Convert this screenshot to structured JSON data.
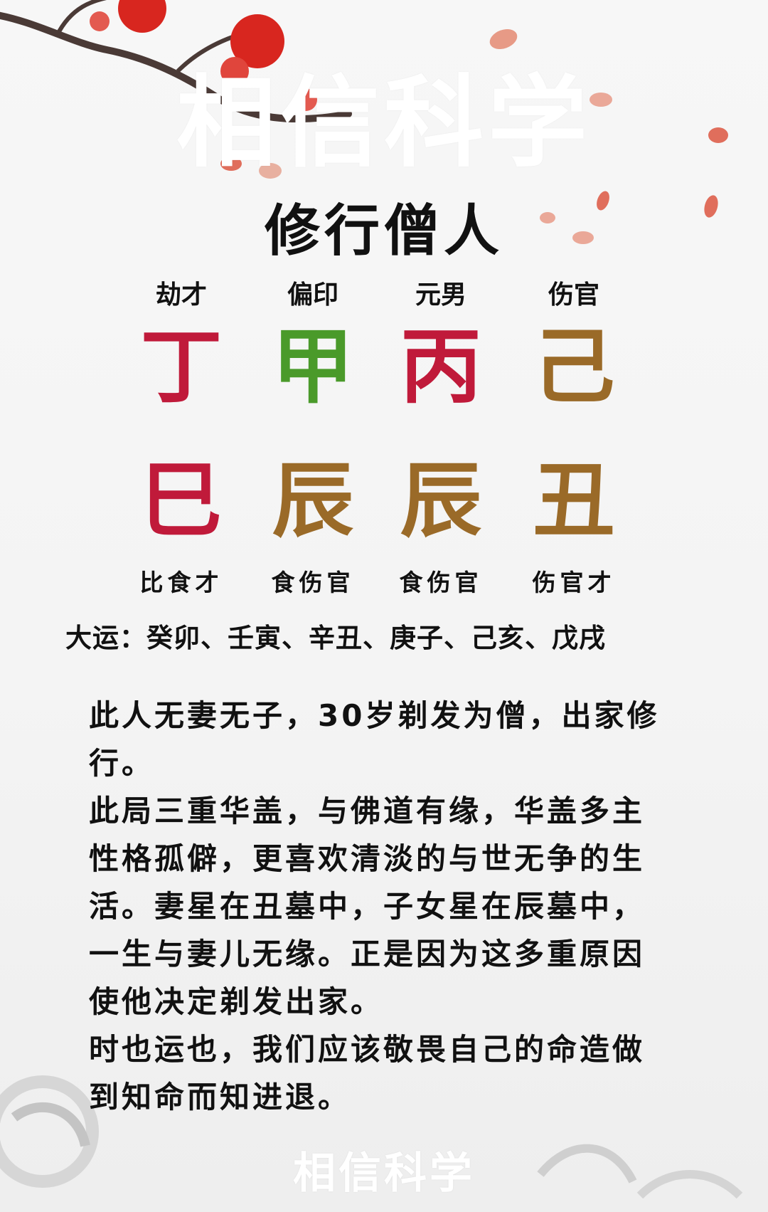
{
  "watermark": {
    "top": "相信科学",
    "bottom": "相信科学"
  },
  "title": "修行僧人",
  "pillars": [
    {
      "god": "劫才",
      "stem": "丁",
      "stem_color": "#c01a3a",
      "branch": "巳",
      "branch_color": "#c01a3a",
      "hidden": "比食才"
    },
    {
      "god": "偏印",
      "stem": "甲",
      "stem_color": "#4a9a2a",
      "branch": "辰",
      "branch_color": "#9a6a28",
      "hidden": "食伤官"
    },
    {
      "god": "元男",
      "stem": "丙",
      "stem_color": "#c01a3a",
      "branch": "辰",
      "branch_color": "#9a6a28",
      "hidden": "食伤官"
    },
    {
      "god": "伤官",
      "stem": "己",
      "stem_color": "#9a6a28",
      "branch": "丑",
      "branch_color": "#9a6a28",
      "hidden": "伤官才"
    }
  ],
  "dayun": "大运：癸卯、壬寅、辛丑、庚子、己亥、戊戌",
  "description": [
    "此人无妻无子，30岁剃发为僧，出家修行。",
    "此局三重华盖，与佛道有缘，华盖多主性格孤僻，更喜欢清淡的与世无争的生活。妻星在丑墓中，子女星在辰墓中，一生与妻儿无缘。正是因为这多重原因使他决定剃发出家。",
    "时也运也，我们应该敬畏自己的命造做到知命而知进退。"
  ]
}
